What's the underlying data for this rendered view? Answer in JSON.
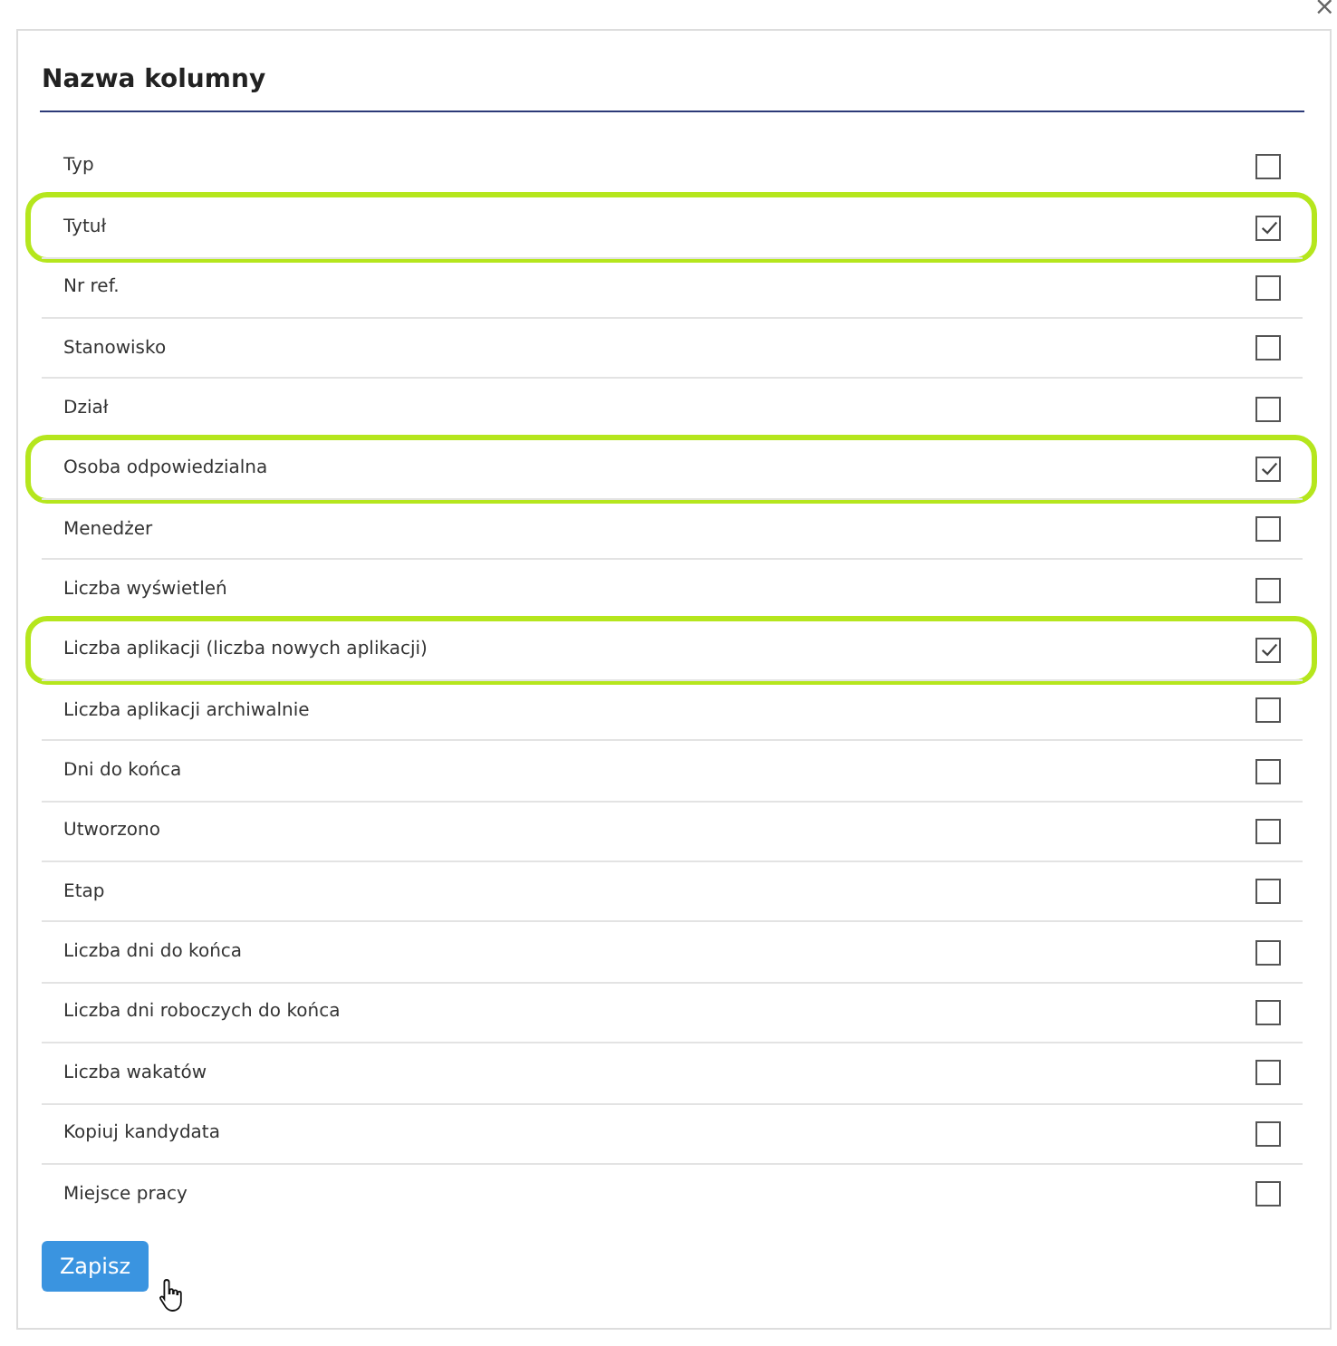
{
  "close_label": "×",
  "title": "Nazwa kolumny",
  "columns": [
    {
      "label": "Typ",
      "checked": false
    },
    {
      "label": "Tytuł",
      "checked": true
    },
    {
      "label": "Nr ref.",
      "checked": false
    },
    {
      "label": "Stanowisko",
      "checked": false
    },
    {
      "label": "Dział",
      "checked": false
    },
    {
      "label": "Osoba odpowiedzialna",
      "checked": true
    },
    {
      "label": "Menedżer",
      "checked": false
    },
    {
      "label": "Liczba wyświetleń",
      "checked": false
    },
    {
      "label": "Liczba aplikacji (liczba nowych aplikacji)",
      "checked": true
    },
    {
      "label": "Liczba aplikacji archiwalnie",
      "checked": false
    },
    {
      "label": "Dni do końca",
      "checked": false
    },
    {
      "label": "Utworzono",
      "checked": false
    },
    {
      "label": "Etap",
      "checked": false
    },
    {
      "label": "Liczba dni do końca",
      "checked": false
    },
    {
      "label": "Liczba dni roboczych do końca",
      "checked": false
    },
    {
      "label": "Liczba wakatów",
      "checked": false
    },
    {
      "label": "Kopiuj kandydata",
      "checked": false
    },
    {
      "label": "Miejsce pracy",
      "checked": false
    }
  ],
  "save_button": "Zapisz"
}
